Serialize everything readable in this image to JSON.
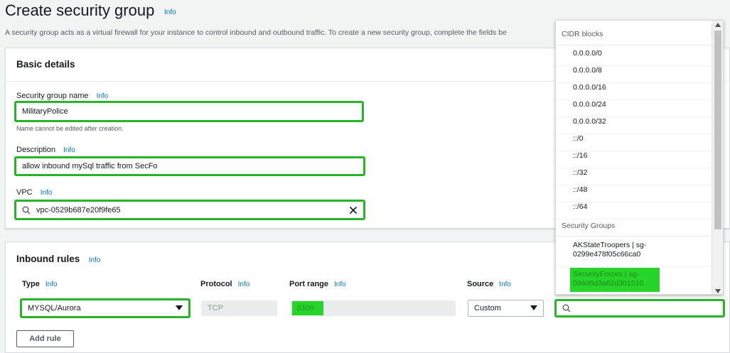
{
  "page": {
    "title": "Create security group",
    "title_info": "Info",
    "intro": "A security group acts as a virtual firewall for your instance to control inbound and outbound traffic. To create a new security group, complete the fields be"
  },
  "basic": {
    "title": "Basic details",
    "name_label": "Security group name",
    "name_info": "Info",
    "name_value": "MilitaryPolice",
    "name_hint": "Name cannot be edited after creation.",
    "desc_label": "Description",
    "desc_info": "Info",
    "desc_value": "allow inbound mySql traffic from SecFo",
    "vpc_label": "VPC",
    "vpc_info": "Info",
    "vpc_value": "vpc-0529b687e20f9fe65"
  },
  "inbound": {
    "title": "Inbound rules",
    "title_info": "Info",
    "columns": {
      "type": "Type",
      "protocol": "Protocol",
      "port_range": "Port range",
      "source": "Source",
      "info": "Info"
    },
    "row": {
      "type": "MYSQL/Aurora",
      "protocol": "TCP",
      "port": "3306",
      "source": "Custom",
      "search_value": ""
    },
    "add_rule": "Add rule"
  },
  "dropdown": {
    "cidr_header": "CIDR blocks",
    "cidr_items": [
      "0.0.0.0/0",
      "0.0.0.0/8",
      "0.0.0.0/16",
      "0.0.0.0/24",
      "0.0.0.0/32",
      "::/0",
      "::/16",
      "::/32",
      "::/48",
      "::/64"
    ],
    "sg_header": "Security Groups",
    "sg_items": [
      {
        "line1": "AKStateTroopers | sg-",
        "line2": "0299e478f05c66ca0"
      },
      {
        "line1": "SecurityForces | sg-",
        "line2": "094d6d3a62d301510"
      }
    ]
  },
  "colors": {
    "highlight": "#27b428",
    "link": "#0073bb"
  }
}
